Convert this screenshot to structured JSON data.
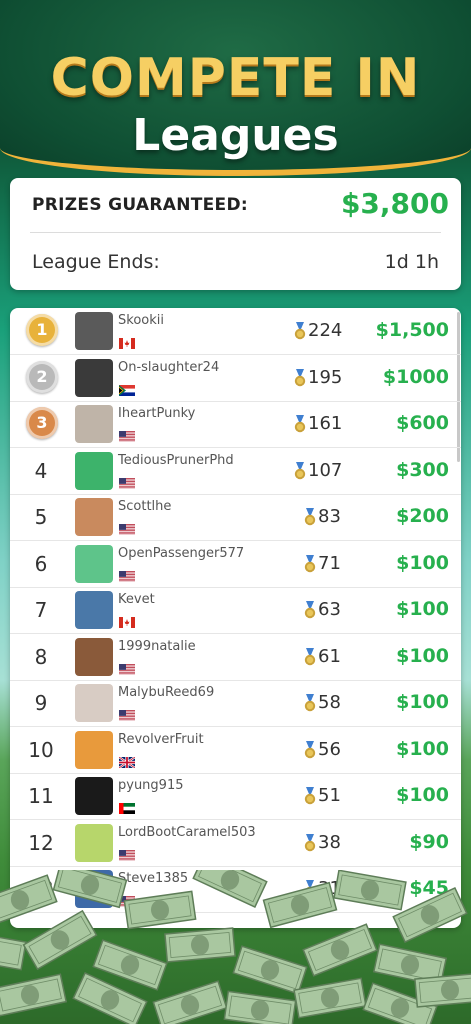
{
  "header": {
    "title_line1": "COMPETE IN",
    "title_line2": "Leagues"
  },
  "summary": {
    "prizes_label": "PRIZES GUARANTEED:",
    "prizes_value": "$3,800",
    "ends_label": "League Ends:",
    "ends_value": "1d 1h"
  },
  "leaderboard": [
    {
      "rank": "1",
      "name": "Skookii",
      "flag": "canada",
      "points": "224",
      "prize": "$1,500",
      "medal": "gold",
      "avatar_color": "#5a5a5a"
    },
    {
      "rank": "2",
      "name": "On-slaughter24",
      "flag": "south-africa",
      "points": "195",
      "prize": "$1000",
      "medal": "silver",
      "avatar_color": "#3a3a3a"
    },
    {
      "rank": "3",
      "name": "IheartPunky",
      "flag": "usa",
      "points": "161",
      "prize": "$600",
      "medal": "bronze",
      "avatar_color": "#bfb4a8"
    },
    {
      "rank": "4",
      "name": "TediousPrunerPhd",
      "flag": "usa",
      "points": "107",
      "prize": "$300",
      "medal": "",
      "avatar_color": "#3db36b"
    },
    {
      "rank": "5",
      "name": "Scottlhe",
      "flag": "usa",
      "points": "83",
      "prize": "$200",
      "medal": "",
      "avatar_color": "#c98a5e"
    },
    {
      "rank": "6",
      "name": "OpenPassenger577",
      "flag": "usa",
      "points": "71",
      "prize": "$100",
      "medal": "",
      "avatar_color": "#5ec48a"
    },
    {
      "rank": "7",
      "name": "Kevet",
      "flag": "canada",
      "points": "63",
      "prize": "$100",
      "medal": "",
      "avatar_color": "#4a78a8"
    },
    {
      "rank": "8",
      "name": "1999natalie",
      "flag": "usa",
      "points": "61",
      "prize": "$100",
      "medal": "",
      "avatar_color": "#8a5a3a"
    },
    {
      "rank": "9",
      "name": "MalybuReed69",
      "flag": "usa",
      "points": "58",
      "prize": "$100",
      "medal": "",
      "avatar_color": "#d8ccc4"
    },
    {
      "rank": "10",
      "name": "RevolverFruit",
      "flag": "uk",
      "points": "56",
      "prize": "$100",
      "medal": "",
      "avatar_color": "#e89a3c"
    },
    {
      "rank": "11",
      "name": "pyung915",
      "flag": "uae",
      "points": "51",
      "prize": "$100",
      "medal": "",
      "avatar_color": "#1a1a1a"
    },
    {
      "rank": "12",
      "name": "LordBootCaramel503",
      "flag": "usa",
      "points": "38",
      "prize": "$90",
      "medal": "",
      "avatar_color": "#b7d66b"
    },
    {
      "rank": "13",
      "name": "Steve1385",
      "flag": "usa",
      "points": "31",
      "prize": "$45",
      "medal": "",
      "avatar_color": "#3e6aa8"
    }
  ],
  "colors": {
    "accent_green": "#27b04e",
    "gold": "#f0b43a"
  }
}
